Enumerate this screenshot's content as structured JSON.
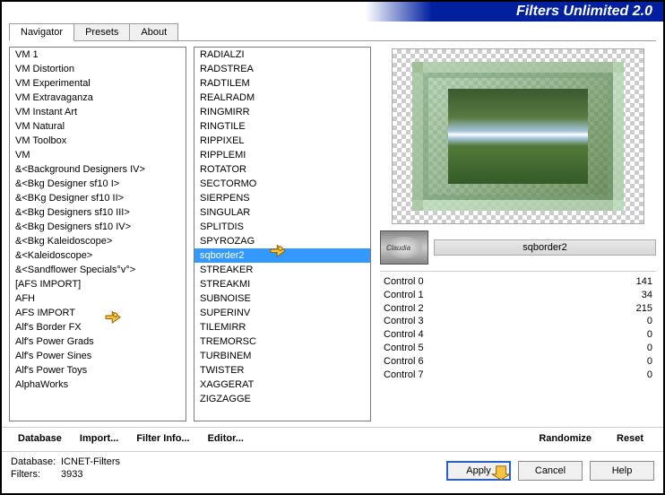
{
  "header": {
    "title": "Filters Unlimited 2.0"
  },
  "tabs": [
    {
      "label": "Navigator",
      "active": true
    },
    {
      "label": "Presets",
      "active": false
    },
    {
      "label": "About",
      "active": false
    }
  ],
  "categories": [
    "VM 1",
    "VM Distortion",
    "VM Experimental",
    "VM Extravaganza",
    "VM Instant Art",
    "VM Natural",
    "VM Toolbox",
    "VM",
    "&<Background Designers IV>",
    "&<Bkg Designer sf10 I>",
    "&<BKg Designer sf10 II>",
    "&<Bkg Designers sf10 III>",
    "&<Bkg Designers sf10 IV>",
    "&<Bkg Kaleidoscope>",
    "&<Kaleidoscope>",
    "&<Sandflower Specials°v°>",
    "[AFS IMPORT]",
    "AFH",
    "AFS IMPORT",
    "Alf's Border FX",
    "Alf's Power Grads",
    "Alf's Power Sines",
    "Alf's Power Toys",
    "AlphaWorks"
  ],
  "categories_selected": "[AFS IMPORT]",
  "filters": [
    "RADIALZI",
    "RADSTREA",
    "RADTILEM",
    "REALRADM",
    "RINGMIRR",
    "RINGTILE",
    "RIPPIXEL",
    "RIPPLEMI",
    "ROTATOR",
    "SECTORMO",
    "SIERPENS",
    "SINGULAR",
    "SPLITDIS",
    "SPYROZAG",
    "sqborder2",
    "STREAKER",
    "STREAKMI",
    "SUBNOISE",
    "SUPERINV",
    "TILEMIRR",
    "TREMORSC",
    "TURBINEM",
    "TWISTER",
    "XAGGERAT",
    "ZIGZAGGE"
  ],
  "filters_selected": "sqborder2",
  "selected_filter_name": "sqborder2",
  "thumb_label": "Claudia",
  "controls": [
    {
      "name": "Control 0",
      "value": 141
    },
    {
      "name": "Control 1",
      "value": 34
    },
    {
      "name": "Control 2",
      "value": 215
    },
    {
      "name": "Control 3",
      "value": 0
    },
    {
      "name": "Control 4",
      "value": 0
    },
    {
      "name": "Control 5",
      "value": 0
    },
    {
      "name": "Control 6",
      "value": 0
    },
    {
      "name": "Control 7",
      "value": 0
    }
  ],
  "toolbar": {
    "database": "Database",
    "import": "Import...",
    "filter_info": "Filter Info...",
    "editor": "Editor...",
    "randomize": "Randomize",
    "reset": "Reset"
  },
  "info": {
    "db_label": "Database:",
    "db_value": "ICNET-Filters",
    "filters_label": "Filters:",
    "filters_value": "3933"
  },
  "buttons": {
    "apply": "Apply",
    "cancel": "Cancel",
    "help": "Help"
  }
}
